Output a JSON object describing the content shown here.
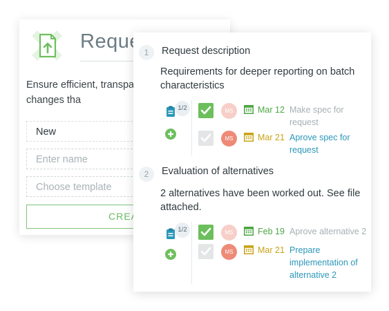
{
  "colors": {
    "accent_green": "#6cbf5c",
    "link_blue": "#2b97b9",
    "date_yellow": "#c9a318",
    "avatar": "#ee8a78"
  },
  "back_card": {
    "logo_icon": "upload-file-icon",
    "title": "Reques",
    "description": "Ensure efficient, transpare handling of all changes tha",
    "status_value": "New",
    "name_placeholder": "Enter name",
    "template_placeholder": "Choose template",
    "create_label": "CREAT"
  },
  "steps": [
    {
      "number": "1",
      "title": "Request description",
      "description": "Requirements for deeper reporting on batch characteristics",
      "progress": "1/2",
      "tasks": [
        {
          "done": true,
          "avatar": "MS",
          "date": "Mar 12",
          "date_color": "green",
          "text": "Make spec for request"
        },
        {
          "done": false,
          "avatar": "MS",
          "date": "Mar 21",
          "date_color": "yellow",
          "text": "Aprove spec for request"
        }
      ]
    },
    {
      "number": "2",
      "title": "Evaluation of alternatives",
      "description": "2 alternatives have been worked out. See file attached.",
      "progress": "1/2",
      "tasks": [
        {
          "done": true,
          "avatar": "MS",
          "date": "Feb 19",
          "date_color": "green",
          "text": "Aprove alternative 2"
        },
        {
          "done": false,
          "avatar": "MS",
          "date": "Mar 21",
          "date_color": "yellow",
          "text": "Prepare implementation of alternative 2"
        }
      ]
    }
  ]
}
